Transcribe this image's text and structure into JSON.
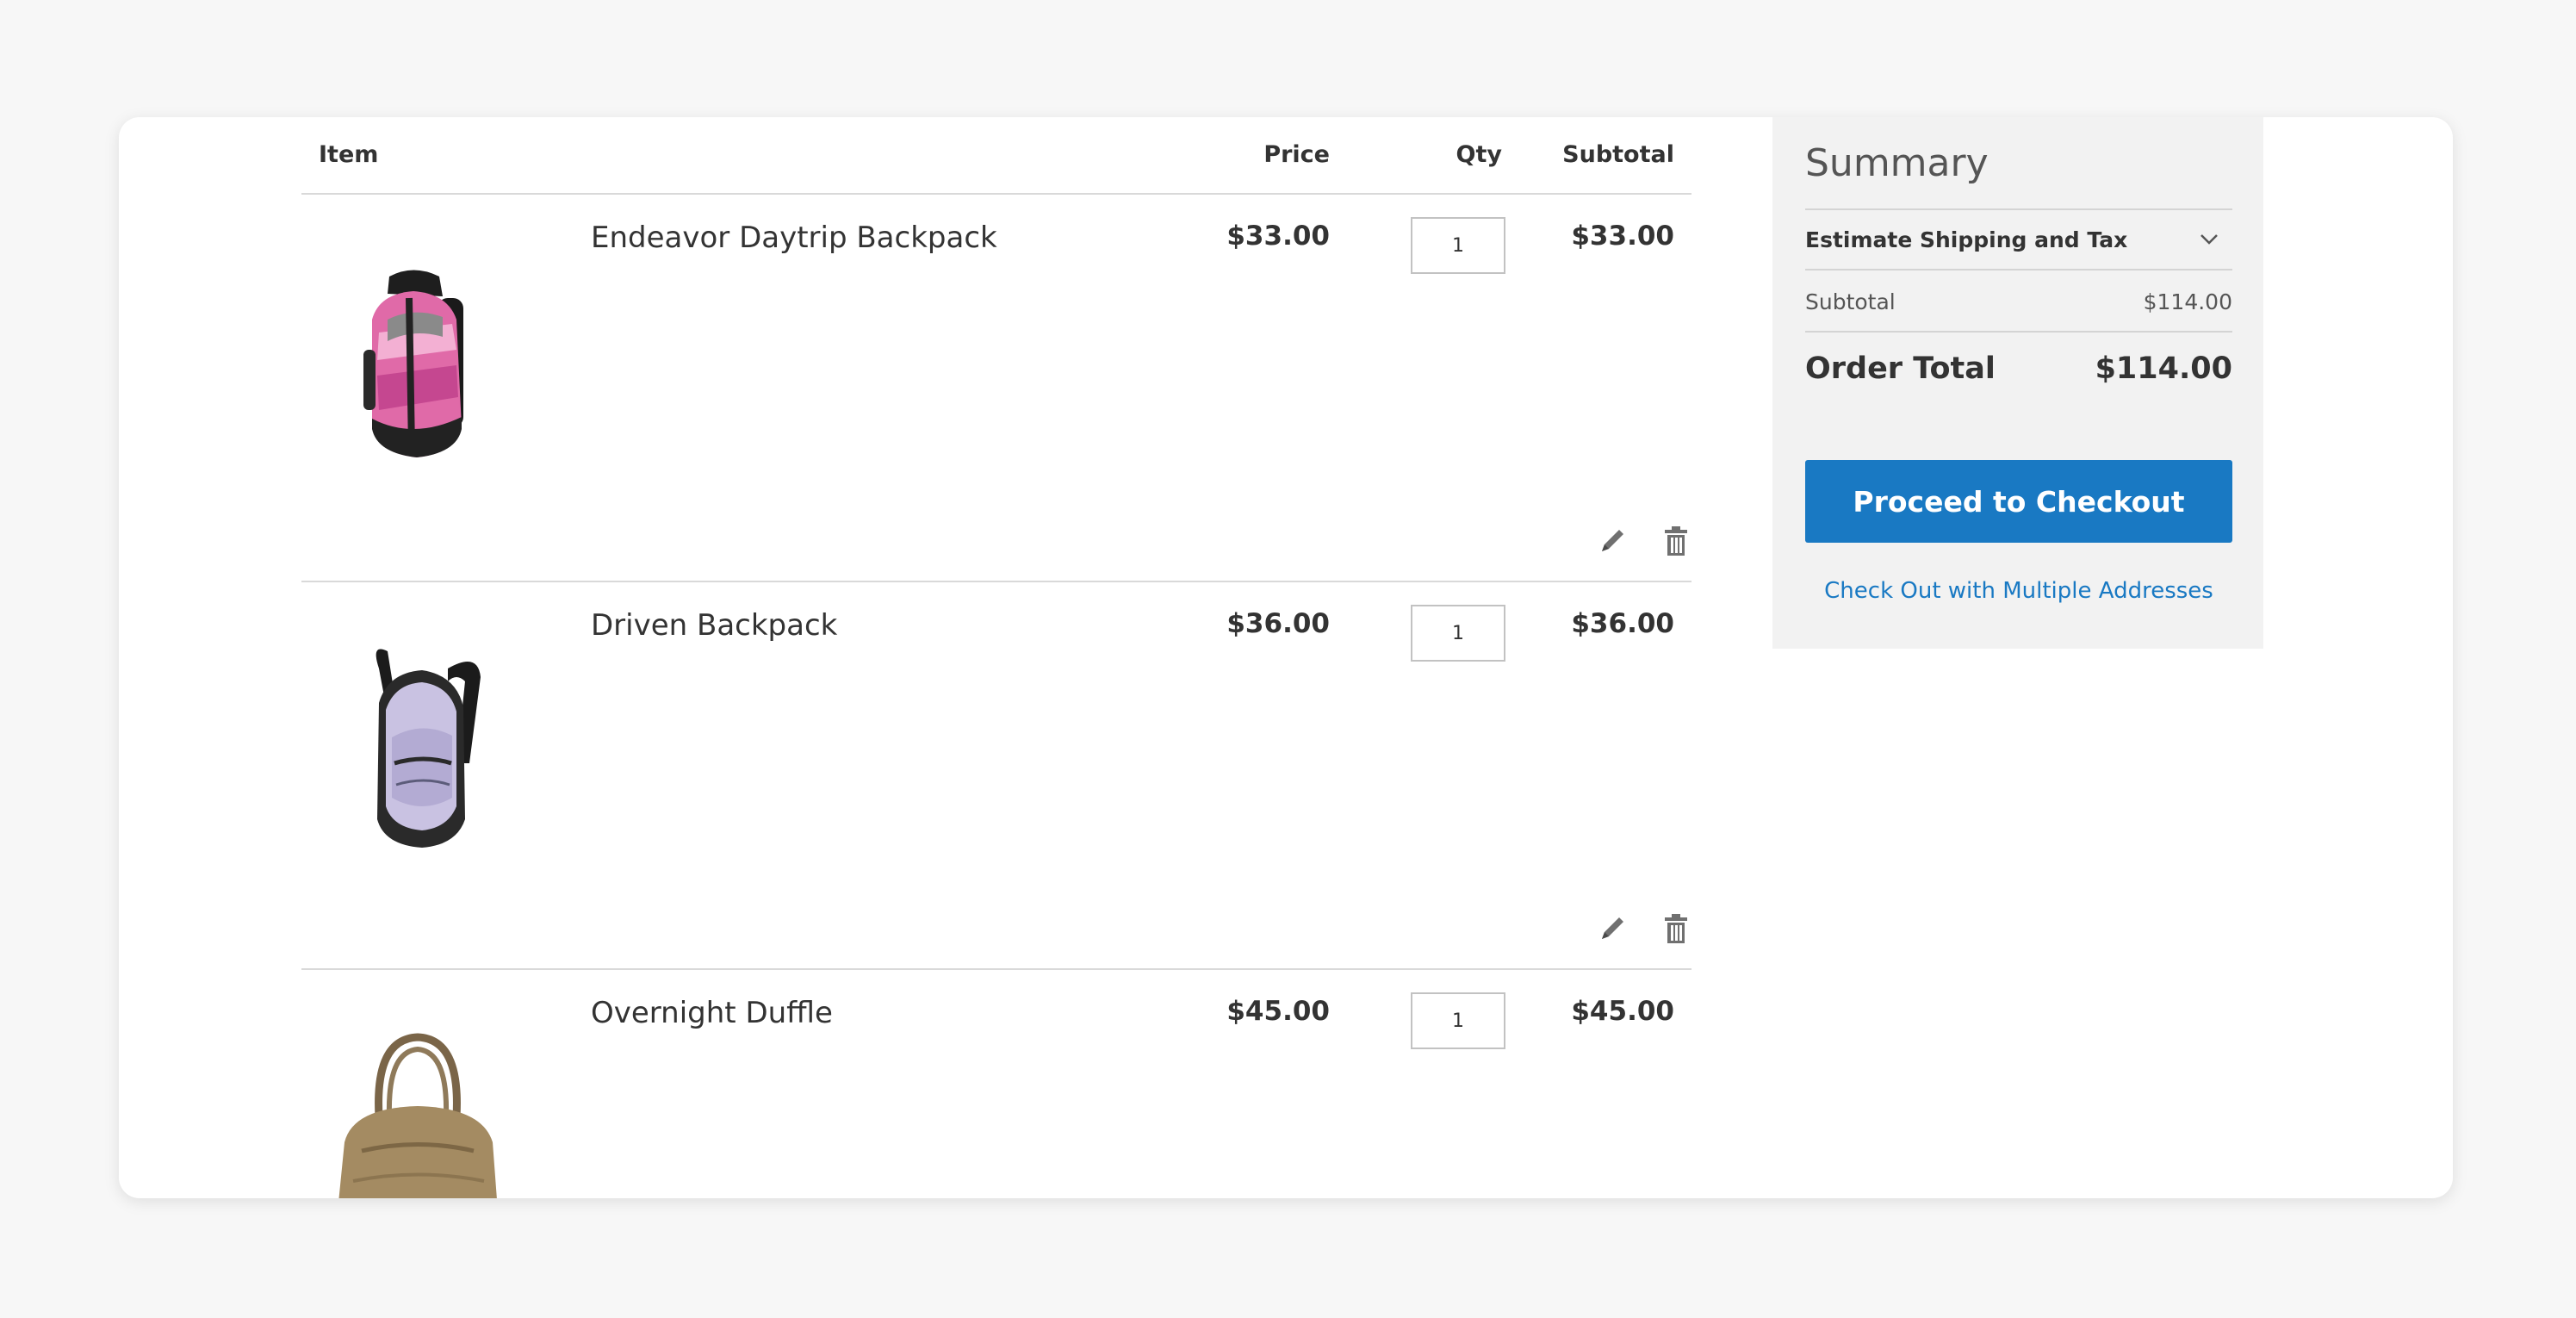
{
  "cart": {
    "columns": {
      "item": "Item",
      "price": "Price",
      "qty": "Qty",
      "subtotal": "Subtotal"
    },
    "items": [
      {
        "name": "Endeavor Daytrip Backpack",
        "price": "$33.00",
        "qty": "1",
        "subtotal": "$33.00",
        "image": "pink-backpack-image"
      },
      {
        "name": "Driven Backpack",
        "price": "$36.00",
        "qty": "1",
        "subtotal": "$36.00",
        "image": "lavender-backpack-image"
      },
      {
        "name": "Overnight Duffle",
        "price": "$45.00",
        "qty": "1",
        "subtotal": "$45.00",
        "image": "tan-duffle-image"
      }
    ],
    "icons": {
      "edit": "pencil-icon",
      "delete": "trash-icon"
    }
  },
  "summary": {
    "title": "Summary",
    "estimate_label": "Estimate Shipping and Tax",
    "subtotal_label": "Subtotal",
    "subtotal_value": "$114.00",
    "order_total_label": "Order Total",
    "order_total_value": "$114.00",
    "checkout_button": "Proceed to Checkout",
    "multi_address_link": "Check Out with Multiple Addresses"
  },
  "colors": {
    "page_background": "#f7f7f7",
    "accent_blue": "#1979c3",
    "summary_background": "#f2f2f2"
  }
}
